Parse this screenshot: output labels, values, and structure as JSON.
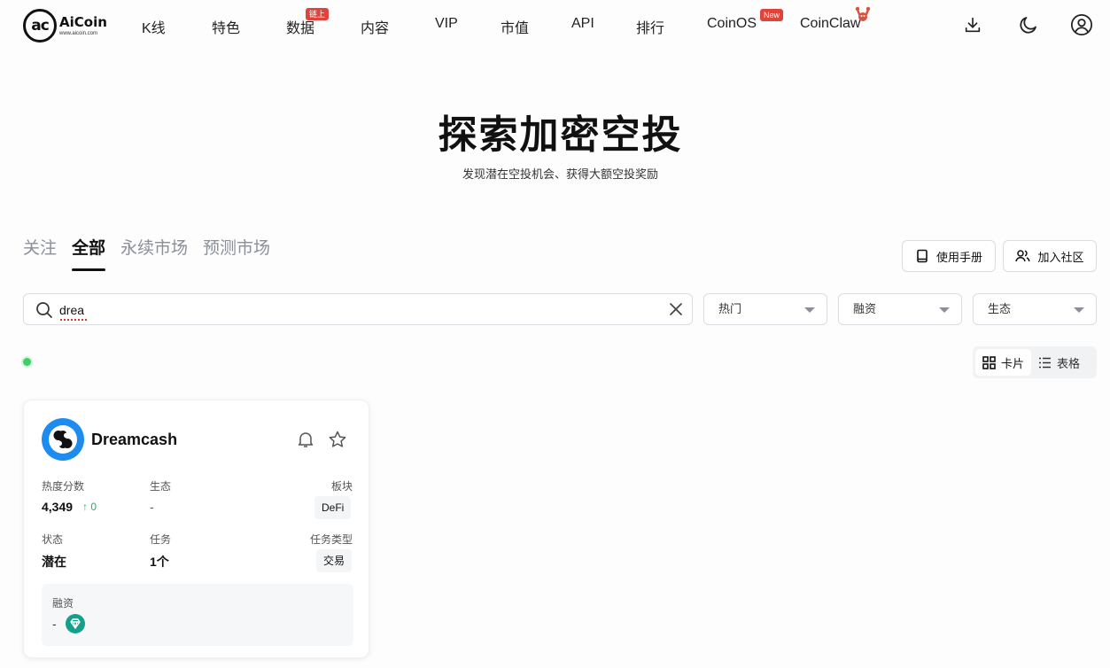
{
  "brand": {
    "name": "AiCoin",
    "url": "www.aicoin.com",
    "mark": "ac"
  },
  "nav": {
    "items": [
      {
        "label": "K线"
      },
      {
        "label": "特色"
      },
      {
        "label": "数据",
        "badge": "链上"
      },
      {
        "label": "内容"
      },
      {
        "label": "VIP"
      },
      {
        "label": "市值"
      },
      {
        "label": "API"
      },
      {
        "label": "排行"
      },
      {
        "label": "CoinOS",
        "badge": "New"
      },
      {
        "label": "CoinClaw"
      }
    ],
    "icons": [
      "download-icon",
      "moon-icon",
      "user-icon"
    ]
  },
  "hero": {
    "title": "探索加密空投",
    "subtitle": "发现潜在空投机会、获得大额空投奖励"
  },
  "tabs": [
    {
      "label": "关注",
      "active": false
    },
    {
      "label": "全部",
      "active": true
    },
    {
      "label": "永续市场",
      "active": false
    },
    {
      "label": "预测市场",
      "active": false
    }
  ],
  "actions": {
    "manual": "使用手册",
    "community": "加入社区"
  },
  "search": {
    "value": "drea"
  },
  "filters": {
    "hot": "热门",
    "funding": "融资",
    "ecosystem": "生态"
  },
  "view": {
    "card": "卡片",
    "table": "表格"
  },
  "colors": {
    "live": "#3ecf6a",
    "up": "#22b35e",
    "badge": "#e0433a",
    "project": "#1d8cf0",
    "funding_badge": "#15a08c"
  },
  "cards": [
    {
      "name": "Dreamcash",
      "heat_label": "热度分数",
      "heat_value": "4,349",
      "heat_delta": "↑ 0",
      "ecosystem_label": "生态",
      "ecosystem_value": "-",
      "sector_label": "板块",
      "sector_value": "DeFi",
      "status_label": "状态",
      "status_value": "潜在",
      "task_label": "任务",
      "task_value": "1个",
      "task_type_label": "任务类型",
      "task_type_value": "交易",
      "funding_label": "融资",
      "funding_value": "-"
    }
  ]
}
